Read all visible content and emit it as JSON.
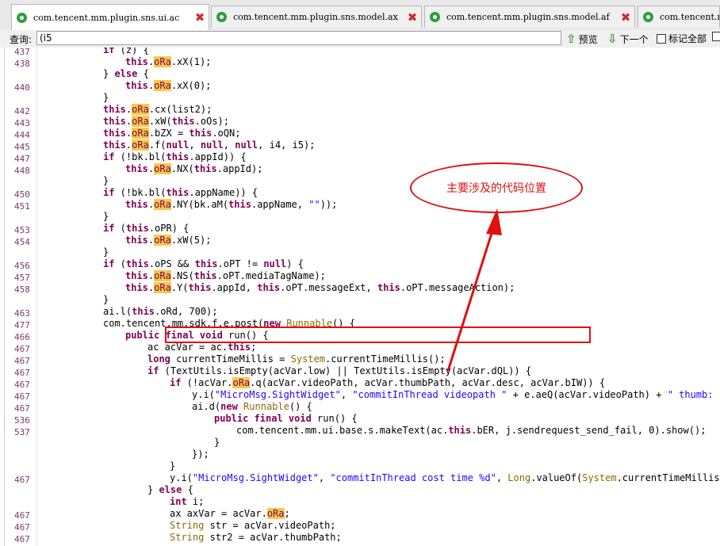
{
  "tabs": [
    {
      "label": "com.tencent.mm.plugin.sns.ui.ac",
      "active": true
    },
    {
      "label": "com.tencent.mm.plugin.sns.model.ax",
      "active": false
    },
    {
      "label": "com.tencent.mm.plugin.sns.model.af",
      "active": false
    },
    {
      "label": "com.tencent.m",
      "active": false
    }
  ],
  "search": {
    "label": "查询:",
    "value": "(i5",
    "prev_label": "预览",
    "next_label": "下一个",
    "mark_all_label": "标记全部"
  },
  "line_numbers": [
    "437",
    "438",
    "440",
    "442",
    "443",
    "444",
    "445",
    "447",
    "448",
    "450",
    "451",
    "453",
    "454",
    "456",
    "457",
    "458",
    "463",
    "477",
    "466",
    "467",
    "467",
    "467",
    "467",
    "467",
    "467",
    "536",
    "537",
    "467",
    "467",
    "467",
    "467"
  ],
  "annotation": {
    "callout_text": "主要涉及的代码位置"
  },
  "colors": {
    "keyword": "#7f0055",
    "highlight": "#f7c84a",
    "annotation_red": "#e01010",
    "string": "#2a00ff"
  }
}
